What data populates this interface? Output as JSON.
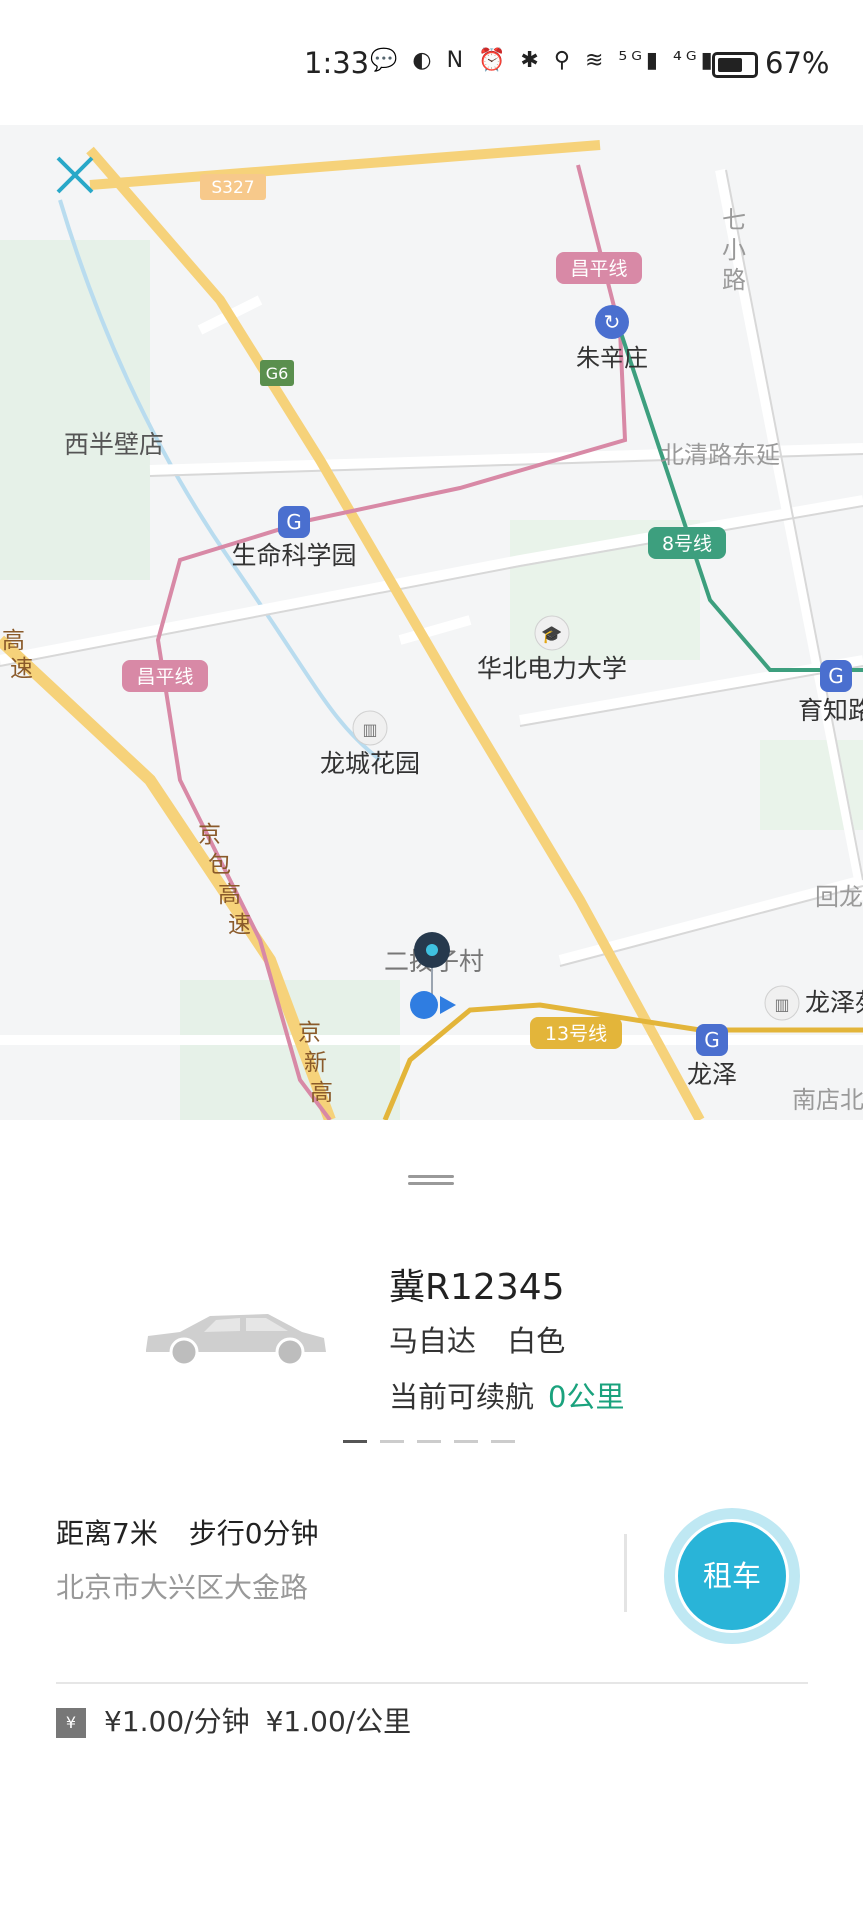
{
  "status_bar": {
    "time": "1:33",
    "icons_text": "💬 ◐ N ⏰ ✱ ⚲ ≋ ⁵ᴳ▮ ⁴ᴳ▮",
    "battery": "67%"
  },
  "map": {
    "labels": {
      "s327": "S327",
      "g6": "G6",
      "changping_top": "昌平线",
      "zhuxinzhuang": "朱辛庄",
      "qixiaolu_a": "七",
      "qixiaolu_b": "小",
      "qixiaolu_c": "路",
      "xibanbidian": "西半壁店",
      "beiqinglu": "北清路东延",
      "line8": "8号线",
      "shengming": "生命科学园",
      "ncepu": "华北电力大学",
      "changping_mid": "昌平线",
      "yuzhi": "育知路",
      "longcheng": "龙城花园",
      "jingbao_a": "京",
      "jingbao_b": "包",
      "jingbao_c": "高",
      "jingbao_d": "速",
      "gaosu_left_a": "高",
      "gaosu_left_b": "速",
      "erbozicun": "二拨子村",
      "line13": "13号线",
      "longze_station": "龙泽",
      "longze_area": "龙泽苑",
      "huilong": "回龙",
      "jingxin_a": "京",
      "jingxin_b": "新",
      "jingxin_c": "高",
      "nandian": "南店北"
    },
    "colors": {
      "expressway": "#f6d27a",
      "changping_line": "#d889a6",
      "line8": "#3d9f7e",
      "line13": "#e3b53a",
      "station": "#4a6fcf"
    }
  },
  "vehicle": {
    "plate": "冀R12345",
    "brand": "马自达",
    "color": "白色",
    "range_label": "当前可续航",
    "range_value": "0公里",
    "page_count": 5,
    "current_page": 1
  },
  "location": {
    "distance": "距离7米",
    "walk": "步行0分钟",
    "address": "北京市大兴区大金路"
  },
  "rent_button": "租车",
  "pricing": {
    "currency_icon": "¥",
    "per_minute": "¥1.00/分钟",
    "per_km": "¥1.00/公里"
  }
}
